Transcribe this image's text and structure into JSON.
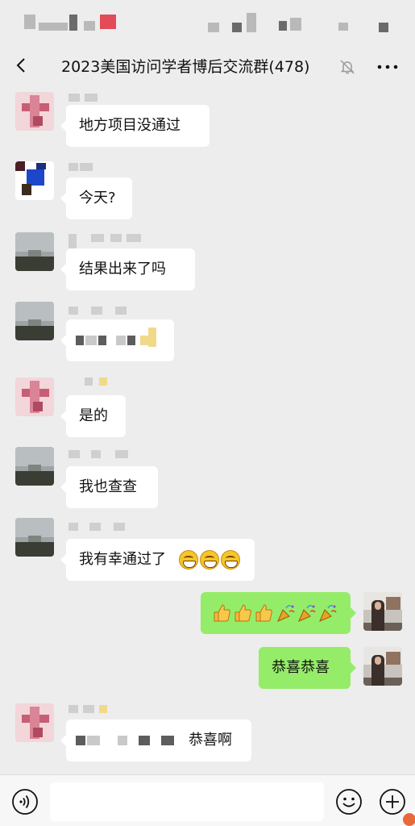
{
  "header": {
    "title": "2023美国访问学者博后交流群(478)",
    "back_icon": "chevron-left-icon",
    "mute_icon": "bell-off-icon",
    "more_icon": "more-horizontal-icon"
  },
  "messages": [
    {
      "direction": "in",
      "text": "地方项目没通过"
    },
    {
      "direction": "in",
      "text": "今天?"
    },
    {
      "direction": "in",
      "text": "结果出来了吗"
    },
    {
      "direction": "in",
      "text": ""
    },
    {
      "direction": "in",
      "text": "是的"
    },
    {
      "direction": "in",
      "text": "我也查查"
    },
    {
      "direction": "in",
      "text": "我有幸通过了",
      "emoji": [
        "grin-icon",
        "grin-icon",
        "grin-icon"
      ]
    },
    {
      "direction": "out",
      "text": "",
      "emoji": [
        "thumbs-up-icon",
        "thumbs-up-icon",
        "thumbs-up-icon",
        "party-popper-icon",
        "party-popper-icon",
        "party-popper-icon"
      ]
    },
    {
      "direction": "out",
      "text": "恭喜恭喜"
    },
    {
      "direction": "in",
      "text": "恭喜啊"
    }
  ],
  "input": {
    "placeholder": "",
    "voice_icon": "voice-icon",
    "emoji_icon": "emoji-icon",
    "plus_icon": "plus-circle-icon"
  },
  "colors": {
    "background": "#ededed",
    "incoming_bubble": "#ffffff",
    "outgoing_bubble": "#95ec69"
  }
}
